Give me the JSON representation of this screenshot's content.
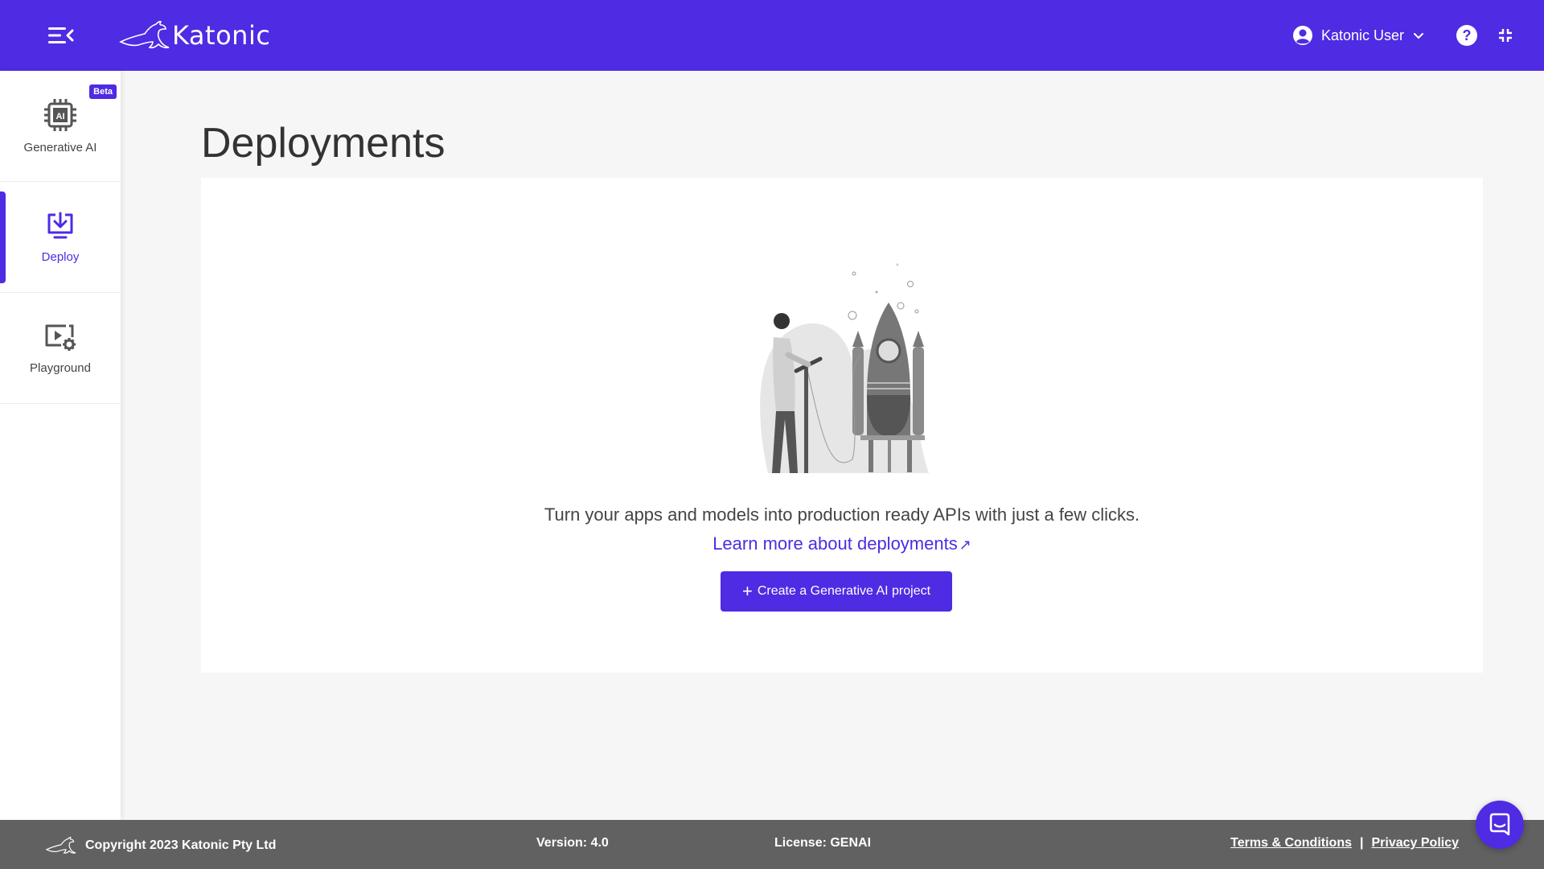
{
  "header": {
    "brand": "Katonic",
    "user_name": "Katonic User",
    "accent_color": "#4f2be3"
  },
  "sidebar": {
    "items": [
      {
        "label": "Generative AI",
        "icon": "ai-chip-icon",
        "badge": "Beta",
        "active": false
      },
      {
        "label": "Deploy",
        "icon": "deploy-download-icon",
        "active": true
      },
      {
        "label": "Playground",
        "icon": "playground-video-gear-icon",
        "active": false
      }
    ]
  },
  "main": {
    "title": "Deployments",
    "description": "Turn your apps and models into production ready APIs with just a few clicks.",
    "learn_more_label": "Learn more about deployments",
    "learn_more_icon": "external-link-arrow-icon",
    "create_button_label": "Create a Generative AI project",
    "illustration": "rocket-launch-illustration"
  },
  "footer": {
    "copyright": "Copyright 2023 Katonic Pty Ltd",
    "version": "Version: 4.0",
    "license": "License: GENAI",
    "terms_label": "Terms & Conditions",
    "separator": "|",
    "privacy_label": "Privacy Policy"
  },
  "chat": {
    "icon": "chat-bubble-icon"
  }
}
